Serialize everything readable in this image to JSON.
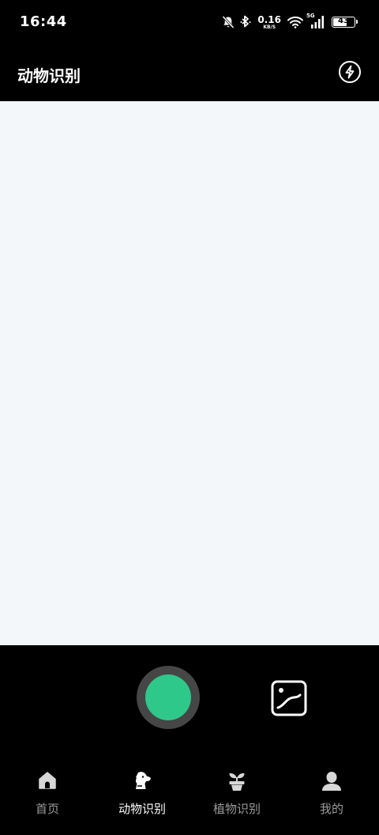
{
  "status_bar": {
    "time": "16:44",
    "net_speed_value": "0.16",
    "net_speed_unit": "KB/S",
    "network_type": "5G",
    "battery": "43",
    "icons": [
      "bell-muted-icon",
      "bluetooth-icon",
      "wifi-icon",
      "signal-icon",
      "battery-icon"
    ]
  },
  "header": {
    "title": "动物识别",
    "flash_icon": "flash-icon"
  },
  "camera": {
    "background": "#f3f7fa"
  },
  "controls": {
    "shutter_color": "#2ec88a",
    "gallery_icon": "gallery-icon"
  },
  "tabs": [
    {
      "label": "首页",
      "icon": "home-icon",
      "active": false
    },
    {
      "label": "动物识别",
      "icon": "dog-icon",
      "active": true
    },
    {
      "label": "植物识别",
      "icon": "plant-icon",
      "active": false
    },
    {
      "label": "我的",
      "icon": "user-icon",
      "active": false
    }
  ]
}
